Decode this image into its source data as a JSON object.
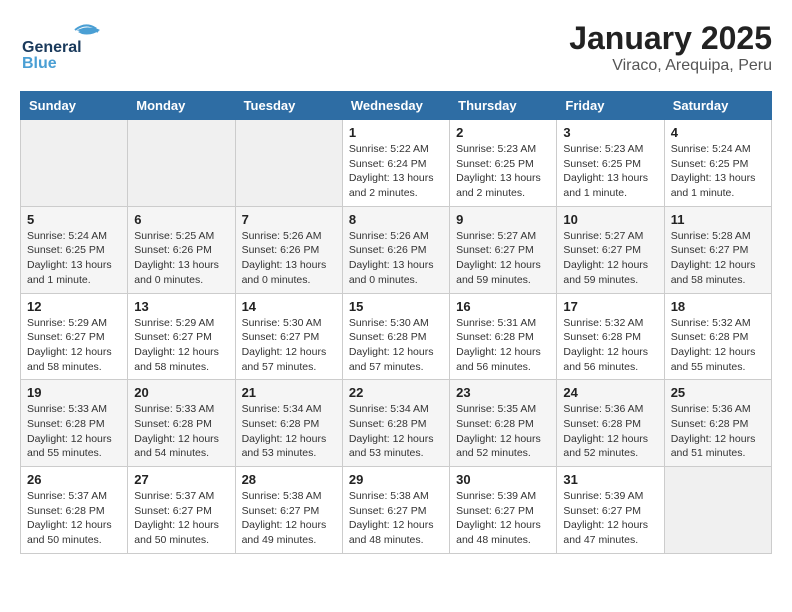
{
  "header": {
    "logo_general": "General",
    "logo_blue": "Blue",
    "title": "January 2025",
    "subtitle": "Viraco, Arequipa, Peru"
  },
  "weekdays": [
    "Sunday",
    "Monday",
    "Tuesday",
    "Wednesday",
    "Thursday",
    "Friday",
    "Saturday"
  ],
  "weeks": [
    [
      {
        "day": "",
        "sunrise": "",
        "sunset": "",
        "daylight": "",
        "empty": true
      },
      {
        "day": "",
        "sunrise": "",
        "sunset": "",
        "daylight": "",
        "empty": true
      },
      {
        "day": "",
        "sunrise": "",
        "sunset": "",
        "daylight": "",
        "empty": true
      },
      {
        "day": "1",
        "sunrise": "Sunrise: 5:22 AM",
        "sunset": "Sunset: 6:24 PM",
        "daylight": "Daylight: 13 hours and 2 minutes."
      },
      {
        "day": "2",
        "sunrise": "Sunrise: 5:23 AM",
        "sunset": "Sunset: 6:25 PM",
        "daylight": "Daylight: 13 hours and 2 minutes."
      },
      {
        "day": "3",
        "sunrise": "Sunrise: 5:23 AM",
        "sunset": "Sunset: 6:25 PM",
        "daylight": "Daylight: 13 hours and 1 minute."
      },
      {
        "day": "4",
        "sunrise": "Sunrise: 5:24 AM",
        "sunset": "Sunset: 6:25 PM",
        "daylight": "Daylight: 13 hours and 1 minute."
      }
    ],
    [
      {
        "day": "5",
        "sunrise": "Sunrise: 5:24 AM",
        "sunset": "Sunset: 6:25 PM",
        "daylight": "Daylight: 13 hours and 1 minute."
      },
      {
        "day": "6",
        "sunrise": "Sunrise: 5:25 AM",
        "sunset": "Sunset: 6:26 PM",
        "daylight": "Daylight: 13 hours and 0 minutes."
      },
      {
        "day": "7",
        "sunrise": "Sunrise: 5:26 AM",
        "sunset": "Sunset: 6:26 PM",
        "daylight": "Daylight: 13 hours and 0 minutes."
      },
      {
        "day": "8",
        "sunrise": "Sunrise: 5:26 AM",
        "sunset": "Sunset: 6:26 PM",
        "daylight": "Daylight: 13 hours and 0 minutes."
      },
      {
        "day": "9",
        "sunrise": "Sunrise: 5:27 AM",
        "sunset": "Sunset: 6:27 PM",
        "daylight": "Daylight: 12 hours and 59 minutes."
      },
      {
        "day": "10",
        "sunrise": "Sunrise: 5:27 AM",
        "sunset": "Sunset: 6:27 PM",
        "daylight": "Daylight: 12 hours and 59 minutes."
      },
      {
        "day": "11",
        "sunrise": "Sunrise: 5:28 AM",
        "sunset": "Sunset: 6:27 PM",
        "daylight": "Daylight: 12 hours and 58 minutes."
      }
    ],
    [
      {
        "day": "12",
        "sunrise": "Sunrise: 5:29 AM",
        "sunset": "Sunset: 6:27 PM",
        "daylight": "Daylight: 12 hours and 58 minutes."
      },
      {
        "day": "13",
        "sunrise": "Sunrise: 5:29 AM",
        "sunset": "Sunset: 6:27 PM",
        "daylight": "Daylight: 12 hours and 58 minutes."
      },
      {
        "day": "14",
        "sunrise": "Sunrise: 5:30 AM",
        "sunset": "Sunset: 6:27 PM",
        "daylight": "Daylight: 12 hours and 57 minutes."
      },
      {
        "day": "15",
        "sunrise": "Sunrise: 5:30 AM",
        "sunset": "Sunset: 6:28 PM",
        "daylight": "Daylight: 12 hours and 57 minutes."
      },
      {
        "day": "16",
        "sunrise": "Sunrise: 5:31 AM",
        "sunset": "Sunset: 6:28 PM",
        "daylight": "Daylight: 12 hours and 56 minutes."
      },
      {
        "day": "17",
        "sunrise": "Sunrise: 5:32 AM",
        "sunset": "Sunset: 6:28 PM",
        "daylight": "Daylight: 12 hours and 56 minutes."
      },
      {
        "day": "18",
        "sunrise": "Sunrise: 5:32 AM",
        "sunset": "Sunset: 6:28 PM",
        "daylight": "Daylight: 12 hours and 55 minutes."
      }
    ],
    [
      {
        "day": "19",
        "sunrise": "Sunrise: 5:33 AM",
        "sunset": "Sunset: 6:28 PM",
        "daylight": "Daylight: 12 hours and 55 minutes."
      },
      {
        "day": "20",
        "sunrise": "Sunrise: 5:33 AM",
        "sunset": "Sunset: 6:28 PM",
        "daylight": "Daylight: 12 hours and 54 minutes."
      },
      {
        "day": "21",
        "sunrise": "Sunrise: 5:34 AM",
        "sunset": "Sunset: 6:28 PM",
        "daylight": "Daylight: 12 hours and 53 minutes."
      },
      {
        "day": "22",
        "sunrise": "Sunrise: 5:34 AM",
        "sunset": "Sunset: 6:28 PM",
        "daylight": "Daylight: 12 hours and 53 minutes."
      },
      {
        "day": "23",
        "sunrise": "Sunrise: 5:35 AM",
        "sunset": "Sunset: 6:28 PM",
        "daylight": "Daylight: 12 hours and 52 minutes."
      },
      {
        "day": "24",
        "sunrise": "Sunrise: 5:36 AM",
        "sunset": "Sunset: 6:28 PM",
        "daylight": "Daylight: 12 hours and 52 minutes."
      },
      {
        "day": "25",
        "sunrise": "Sunrise: 5:36 AM",
        "sunset": "Sunset: 6:28 PM",
        "daylight": "Daylight: 12 hours and 51 minutes."
      }
    ],
    [
      {
        "day": "26",
        "sunrise": "Sunrise: 5:37 AM",
        "sunset": "Sunset: 6:28 PM",
        "daylight": "Daylight: 12 hours and 50 minutes."
      },
      {
        "day": "27",
        "sunrise": "Sunrise: 5:37 AM",
        "sunset": "Sunset: 6:27 PM",
        "daylight": "Daylight: 12 hours and 50 minutes."
      },
      {
        "day": "28",
        "sunrise": "Sunrise: 5:38 AM",
        "sunset": "Sunset: 6:27 PM",
        "daylight": "Daylight: 12 hours and 49 minutes."
      },
      {
        "day": "29",
        "sunrise": "Sunrise: 5:38 AM",
        "sunset": "Sunset: 6:27 PM",
        "daylight": "Daylight: 12 hours and 48 minutes."
      },
      {
        "day": "30",
        "sunrise": "Sunrise: 5:39 AM",
        "sunset": "Sunset: 6:27 PM",
        "daylight": "Daylight: 12 hours and 48 minutes."
      },
      {
        "day": "31",
        "sunrise": "Sunrise: 5:39 AM",
        "sunset": "Sunset: 6:27 PM",
        "daylight": "Daylight: 12 hours and 47 minutes."
      },
      {
        "day": "",
        "sunrise": "",
        "sunset": "",
        "daylight": "",
        "empty": true
      }
    ]
  ]
}
